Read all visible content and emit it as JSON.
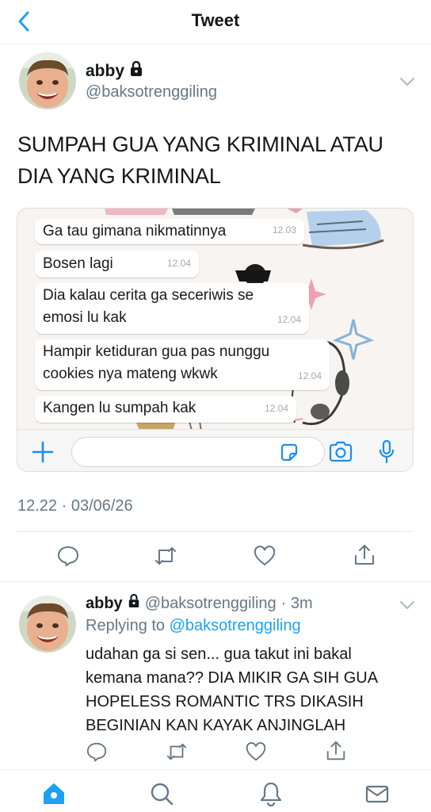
{
  "header": {
    "title": "Tweet"
  },
  "tweet": {
    "author_name": "abby",
    "author_handle": "@baksotrenggiling",
    "text": "SUMPAH GUA YANG KRIMINAL ATAU DIA YANG KRIMINAL",
    "timestamp": "12.22 · 03/06/26"
  },
  "chat": {
    "messages": [
      {
        "text": "Ga tau gimana nikmatinnya",
        "time": "12.03"
      },
      {
        "text": "Bosen lagi",
        "time": "12.04"
      },
      {
        "text": "Dia kalau cerita ga seceriwis se emosi lu kak",
        "time": "12.04"
      },
      {
        "text": "Hampir ketiduran gua pas nunggu cookies nya mateng wkwk",
        "time": "12.04"
      },
      {
        "text": "Kangen lu sumpah kak",
        "time": "12.04"
      }
    ]
  },
  "reply": {
    "author_name": "abby",
    "author_handle": "@baksotrenggiling",
    "age": "· 3m",
    "replying_prefix": "Replying to ",
    "replying_to": "@baksotrenggiling",
    "text": "udahan ga si sen... gua takut ini bakal kemana mana?? DIA MIKIR GA SIH GUA HOPELESS ROMANTIC TRS DIKASIH BEGINIAN KAN KAYAK ANJINGLAH"
  },
  "colors": {
    "accent": "#1da1f2",
    "secondary_text": "#657786",
    "divider": "#e6ecf0"
  },
  "icons": {
    "back": "chevron-left-icon",
    "lock": "lock-icon",
    "more": "chevron-down-icon",
    "reply": "comment-icon",
    "retweet": "retweet-icon",
    "like": "heart-icon",
    "share": "share-icon",
    "home": "home-icon",
    "search": "search-icon",
    "notifications": "bell-icon",
    "messages": "mail-icon"
  }
}
